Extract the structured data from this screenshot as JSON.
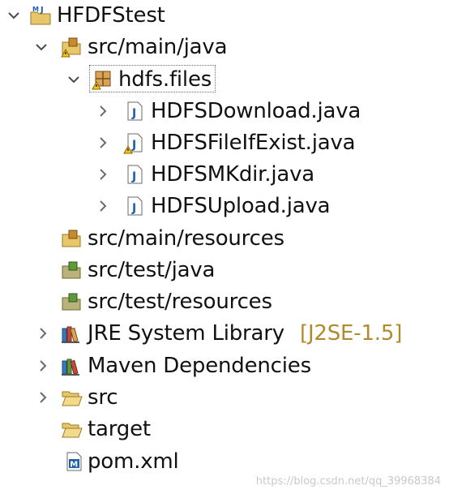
{
  "tree": {
    "project": {
      "label": "HFDFStest",
      "icon": "maven-java-project-icon"
    },
    "items": [
      {
        "label": "src/main/java",
        "icon": "source-folder-warning-icon"
      },
      {
        "label": "hdfs.files",
        "icon": "package-warning-icon"
      },
      {
        "label": "HDFSDownload.java",
        "icon": "java-file-icon"
      },
      {
        "label": "HDFSFileIfExist.java",
        "icon": "java-file-warning-icon"
      },
      {
        "label": "HDFSMKdir.java",
        "icon": "java-file-icon"
      },
      {
        "label": "HDFSUpload.java",
        "icon": "java-file-icon"
      },
      {
        "label": "src/main/resources",
        "icon": "source-folder-icon"
      },
      {
        "label": "src/test/java",
        "icon": "test-source-folder-icon"
      },
      {
        "label": "src/test/resources",
        "icon": "test-source-folder-icon"
      },
      {
        "label": "JRE System Library",
        "decoration": "[J2SE-1.5]",
        "icon": "library-icon"
      },
      {
        "label": "Maven Dependencies",
        "icon": "library-icon"
      },
      {
        "label": "src",
        "icon": "folder-open-icon"
      },
      {
        "label": "target",
        "icon": "folder-open-icon"
      },
      {
        "label": "pom.xml",
        "icon": "maven-pom-icon"
      }
    ]
  },
  "colors": {
    "chevron": "#5a5a5a",
    "decoration": "#b08a2e",
    "warning": "#f0c419",
    "java_blue": "#1f5fa8"
  },
  "watermark": "https://blog.csdn.net/qq_39968384"
}
